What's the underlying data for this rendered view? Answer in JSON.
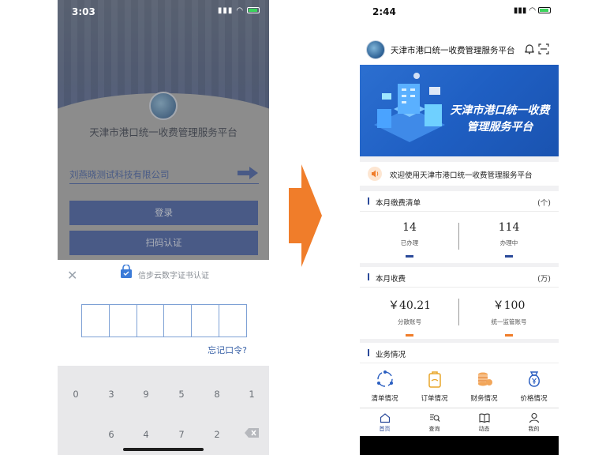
{
  "left": {
    "status_time": "3:03",
    "app_title": "天津市港口统一收费管理服务平台",
    "company_field": "刘燕晓测试科技有限公司",
    "login_label": "登录",
    "scan_label": "扫码认证",
    "sheet_title": "信步云数字证书认证",
    "forgot_label": "忘记口令?",
    "keys": [
      "0",
      "3",
      "9",
      "5",
      "8",
      "1",
      "6",
      "4",
      "7",
      "2"
    ]
  },
  "right": {
    "status_time": "2:44",
    "app_title": "天津市港口统一收费管理服务平台",
    "banner_line1": "天津市港口统一收费",
    "banner_line2": "管理服务平台",
    "notice": "欢迎使用天津市港口统一收费管理服务平台",
    "monthly_list": {
      "title": "本月缴费清单",
      "unit": "(个)",
      "stats": [
        {
          "value": "14",
          "label": "已办理"
        },
        {
          "value": "114",
          "label": "办理中"
        }
      ]
    },
    "monthly_fee": {
      "title": "本月收费",
      "unit": "(万)",
      "stats": [
        {
          "value": "￥40.21",
          "label": "分散账号"
        },
        {
          "value": "￥100",
          "label": "统一监管账号"
        }
      ]
    },
    "business": {
      "title": "业务情况",
      "items": [
        {
          "label": "清单情况",
          "icon": "cycle-icon"
        },
        {
          "label": "订单情况",
          "icon": "bag-icon"
        },
        {
          "label": "财务情况",
          "icon": "coins-icon"
        },
        {
          "label": "价格情况",
          "icon": "money-bag-icon"
        }
      ]
    },
    "tabs": [
      {
        "label": "首页",
        "icon": "home-icon"
      },
      {
        "label": "查询",
        "icon": "search-list-icon"
      },
      {
        "label": "动态",
        "icon": "book-icon"
      },
      {
        "label": "我的",
        "icon": "user-icon"
      }
    ],
    "colors": {
      "brand": "#2b4a9a",
      "accent_orange": "#f07d2a"
    }
  }
}
